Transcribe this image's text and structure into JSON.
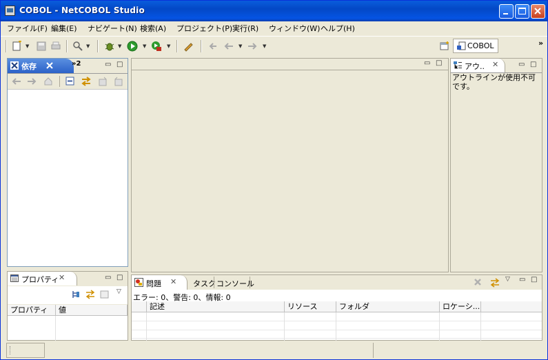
{
  "window": {
    "title": "COBOL - NetCOBOL Studio"
  },
  "menubar": {
    "items": [
      "ファイル(F)",
      "編集(E)",
      "ナビゲート(N)",
      "検索(A)",
      "プロジェクト(P)",
      "実行(R)",
      "ウィンドウ(W)",
      "ヘルプ(H)"
    ]
  },
  "toolbar": {
    "perspective_label": "COBOL",
    "overflow": "»"
  },
  "dependency_view": {
    "tab_label": "依存",
    "overflow_count": "»2"
  },
  "outline_view": {
    "tab_label": "アウ..",
    "message": "アウトラインが使用不可です。"
  },
  "properties_view": {
    "tab_label": "プロパティ",
    "columns": [
      "プロパティ",
      "値"
    ]
  },
  "problems_view": {
    "tabs": [
      "問題",
      "タスク",
      "コンソール"
    ],
    "summary": "エラー: 0、警告: 0、情報: 0",
    "columns": [
      "記述",
      "リソース",
      "フォルダ",
      "ロケーシ..."
    ]
  },
  "colors": {
    "titlebar": "#0348c6",
    "chrome": "#ece9d8",
    "active_view_border": "#7f9db9"
  }
}
